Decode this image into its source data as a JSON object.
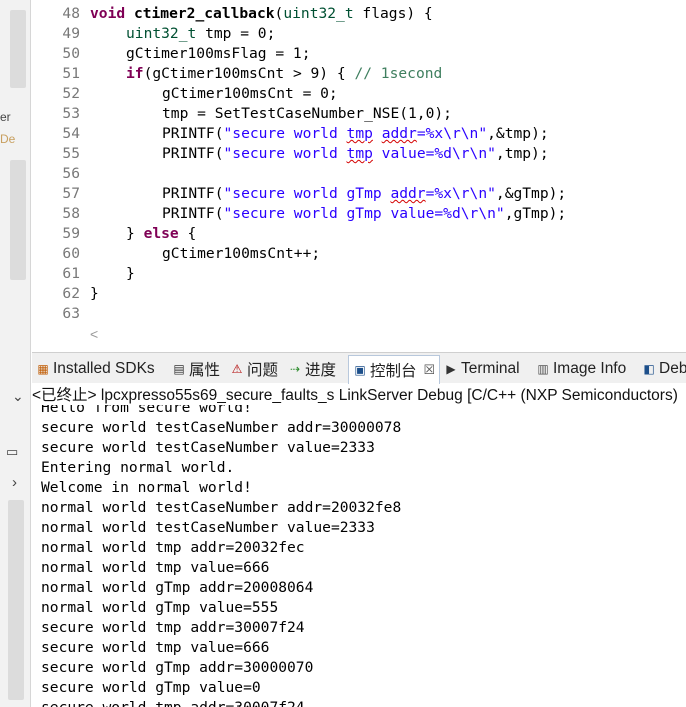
{
  "editor": {
    "lines": [
      {
        "num": "48",
        "indent": 0,
        "tokens": [
          {
            "t": "void",
            "c": "kw"
          },
          {
            "t": " "
          },
          {
            "t": "ctimer2_callback",
            "c": "bold"
          },
          {
            "t": "("
          },
          {
            "t": "uint32_t",
            "c": "ty"
          },
          {
            "t": " flags) {"
          }
        ]
      },
      {
        "num": "49",
        "indent": 1,
        "tokens": [
          {
            "t": "uint32_t",
            "c": "ty"
          },
          {
            "t": " tmp = 0;"
          }
        ]
      },
      {
        "num": "50",
        "indent": 1,
        "tokens": [
          {
            "t": "gCtimer100msFlag = 1;"
          }
        ]
      },
      {
        "num": "51",
        "indent": 1,
        "tokens": [
          {
            "t": "if",
            "c": "kw"
          },
          {
            "t": "(gCtimer100msCnt > 9) { "
          },
          {
            "t": "// 1second",
            "c": "cm"
          }
        ]
      },
      {
        "num": "52",
        "indent": 2,
        "tokens": [
          {
            "t": "gCtimer100msCnt = 0;"
          }
        ]
      },
      {
        "num": "53",
        "indent": 2,
        "tokens": [
          {
            "t": "tmp = SetTestCaseNumber_NSE(1,0);"
          }
        ]
      },
      {
        "num": "54",
        "indent": 2,
        "tokens": [
          {
            "t": "PRINTF("
          },
          {
            "t": "\"secure world ",
            "c": "st"
          },
          {
            "t": "tmp",
            "c": "st squig"
          },
          {
            "t": " ",
            "c": "st"
          },
          {
            "t": "addr",
            "c": "st squig"
          },
          {
            "t": "=%x\\r\\n\"",
            "c": "st"
          },
          {
            "t": ",&tmp);"
          }
        ]
      },
      {
        "num": "55",
        "indent": 2,
        "tokens": [
          {
            "t": "PRINTF("
          },
          {
            "t": "\"secure world ",
            "c": "st"
          },
          {
            "t": "tmp",
            "c": "st squig"
          },
          {
            "t": " value=%d\\r\\n\"",
            "c": "st"
          },
          {
            "t": ",tmp);"
          }
        ]
      },
      {
        "num": "56",
        "indent": 0,
        "tokens": []
      },
      {
        "num": "57",
        "indent": 2,
        "tokens": [
          {
            "t": "PRINTF("
          },
          {
            "t": "\"secure world gTmp ",
            "c": "st"
          },
          {
            "t": "addr",
            "c": "st squig"
          },
          {
            "t": "=%x\\r\\n\"",
            "c": "st"
          },
          {
            "t": ",&gTmp);"
          }
        ]
      },
      {
        "num": "58",
        "indent": 2,
        "tokens": [
          {
            "t": "PRINTF("
          },
          {
            "t": "\"secure world gTmp value=%d\\r\\n\"",
            "c": "st"
          },
          {
            "t": ",gTmp);"
          }
        ]
      },
      {
        "num": "59",
        "indent": 1,
        "tokens": [
          {
            "t": "} "
          },
          {
            "t": "else",
            "c": "kw"
          },
          {
            "t": " {"
          }
        ]
      },
      {
        "num": "60",
        "indent": 2,
        "tokens": [
          {
            "t": "gCtimer100msCnt++;"
          }
        ]
      },
      {
        "num": "61",
        "indent": 1,
        "tokens": [
          {
            "t": "}"
          }
        ]
      },
      {
        "num": "62",
        "indent": 0,
        "tokens": [
          {
            "t": "}"
          }
        ]
      },
      {
        "num": "63",
        "indent": 0,
        "tokens": []
      }
    ],
    "scroll_glyph": "<"
  },
  "sidebar": {
    "text1": "er",
    "text2": "De",
    "chevron_down": "⌄",
    "minimize": "▭",
    "arrow": "›"
  },
  "tabs": [
    {
      "label": "Installed SDKs",
      "icon": "sdk-icon",
      "glyph": "▦",
      "color": "#c05a00"
    },
    {
      "label": "属性",
      "icon": "properties-icon",
      "glyph": "▤",
      "color": "#333"
    },
    {
      "label": "问题",
      "icon": "problems-icon",
      "glyph": "⚠",
      "color": "#b00000"
    },
    {
      "label": "进度",
      "icon": "progress-icon",
      "glyph": "⇢",
      "color": "#2a8a2a"
    },
    {
      "label": "控制台",
      "icon": "console-icon",
      "glyph": "▣",
      "color": "#1d4f8a",
      "active": true,
      "close": "☒"
    },
    {
      "label": "Terminal",
      "icon": "terminal-icon",
      "glyph": "▶",
      "color": "#333"
    },
    {
      "label": "Image Info",
      "icon": "image-info-icon",
      "glyph": "▥",
      "color": "#555"
    },
    {
      "label": "Deb",
      "icon": "debug-icon",
      "glyph": "◧",
      "color": "#1d4f8a"
    }
  ],
  "console": {
    "header": "<已终止> lpcxpresso55s69_secure_faults_s LinkServer Debug [C/C++ (NXP Semiconductors)",
    "lines": [
      "Hello from secure world!",
      "secure world testCaseNumber addr=30000078",
      "secure world testCaseNumber value=2333",
      "Entering normal world.",
      "Welcome in normal world!",
      "normal world testCaseNumber addr=20032fe8",
      "normal world testCaseNumber value=2333",
      "normal world tmp addr=20032fec",
      "normal world tmp value=666",
      "normal world gTmp addr=20008064",
      "normal world gTmp value=555",
      "secure world tmp addr=30007f24",
      "secure world tmp value=666",
      "secure world gTmp addr=30000070",
      "secure world gTmp value=0",
      "secure world tmp addr=30007f24"
    ]
  }
}
